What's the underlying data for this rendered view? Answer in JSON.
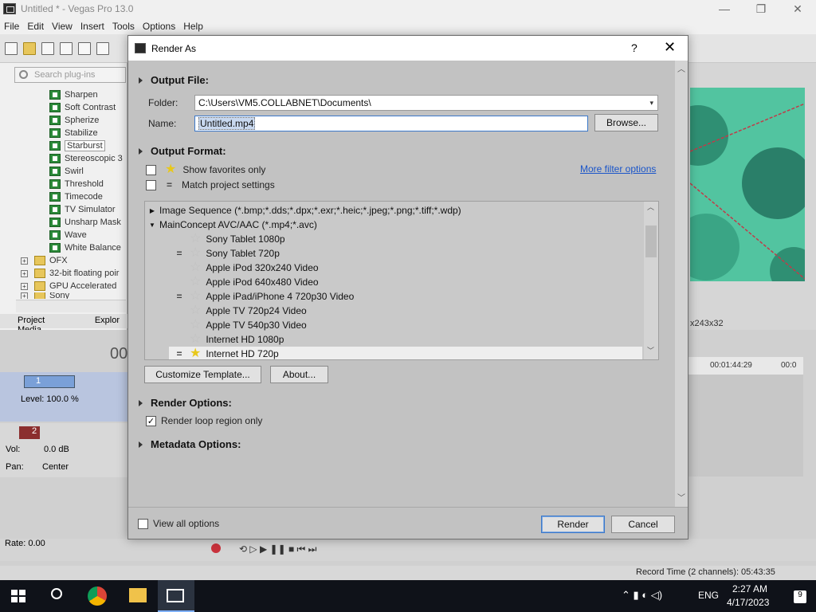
{
  "app": {
    "title": "Untitled * - Vegas Pro 13.0",
    "window_buttons": [
      "—",
      "❐",
      "✕"
    ]
  },
  "menu": [
    "File",
    "Edit",
    "View",
    "Insert",
    "Tools",
    "Options",
    "Help"
  ],
  "plugin_panel": {
    "search_placeholder": "Search plug-ins",
    "items": [
      "Sharpen",
      "Soft Contrast",
      "Spherize",
      "Stabilize",
      "Starburst",
      "Stereoscopic 3",
      "Swirl",
      "Threshold",
      "Timecode",
      "TV Simulator",
      "Unsharp Mask",
      "Wave",
      "White Balance"
    ],
    "selected": "Starburst",
    "folders": [
      "OFX",
      "32-bit floating poir",
      "GPU Accelerated",
      "Sony"
    ],
    "tabs": [
      "Project Media",
      "Explor"
    ]
  },
  "preview": {
    "info": "x243x32"
  },
  "timeline": {
    "big_timecode": "00",
    "track1": {
      "number": "1",
      "level_label": "Level: 100.0 %"
    },
    "track2": {
      "number": "2",
      "vol_label": "Vol:",
      "vol_value": "0.0 dB",
      "pan_label": "Pan:",
      "pan_value": "Center"
    },
    "ruler": [
      "00:01:44:29",
      "00:0"
    ],
    "rate": "Rate: 0.00",
    "record_time": "Record Time (2 channels): 05:43:35"
  },
  "dialog": {
    "title": "Render As",
    "help": "?",
    "close": "✕",
    "output_file": {
      "header": "Output File:",
      "folder_label": "Folder:",
      "folder_value": "C:\\Users\\VM5.COLLABNET\\Documents\\",
      "name_label": "Name:",
      "name_value": "Untitled.mp4",
      "browse": "Browse..."
    },
    "output_format": {
      "header": "Output Format:",
      "show_favorites": "Show favorites only",
      "match_project": "Match project settings",
      "more_filter": "More filter options",
      "formats": [
        {
          "label": "Image Sequence (*.bmp;*.dds;*.dpx;*.exr;*.heic;*.jpeg;*.png;*.tiff;*.wdp)",
          "expanded": false
        },
        {
          "label": "MainConcept AVC/AAC (*.mp4;*.avc)",
          "expanded": true
        }
      ],
      "templates": [
        {
          "label": "Sony Tablet 1080p",
          "match": false,
          "favorite": false
        },
        {
          "label": "Sony Tablet 720p",
          "match": true,
          "favorite": false
        },
        {
          "label": "Apple iPod 320x240 Video",
          "match": false,
          "favorite": false
        },
        {
          "label": "Apple iPod 640x480 Video",
          "match": false,
          "favorite": false
        },
        {
          "label": "Apple iPad/iPhone 4 720p30 Video",
          "match": true,
          "favorite": false
        },
        {
          "label": "Apple TV 720p24 Video",
          "match": false,
          "favorite": false
        },
        {
          "label": "Apple TV 540p30 Video",
          "match": false,
          "favorite": false
        },
        {
          "label": "Internet HD 1080p",
          "match": false,
          "favorite": false
        },
        {
          "label": "Internet HD 720p",
          "match": true,
          "favorite": true,
          "selected": true
        }
      ],
      "customize": "Customize Template...",
      "about": "About..."
    },
    "render_options": {
      "header": "Render Options:",
      "loop_region": "Render loop region only",
      "loop_checked": true
    },
    "metadata_header": "Metadata Options:",
    "view_all": "View all options",
    "render": "Render",
    "cancel": "Cancel"
  },
  "taskbar": {
    "lang": "ENG",
    "time": "2:27 AM",
    "date": "4/17/2023",
    "notif": "9"
  }
}
